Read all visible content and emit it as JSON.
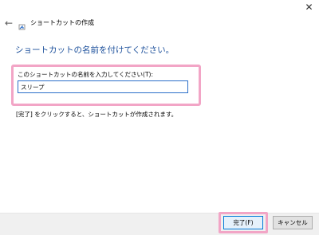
{
  "window": {
    "title": "ショートカットの作成",
    "close_glyph": "✕",
    "back_glyph": "←"
  },
  "main": {
    "heading": "ショートカットの名前を付けてください。",
    "field_label": "このショートカットの名前を入力してください(T):",
    "name_value": "スリープ",
    "info_text": "[完了] をクリックすると、ショートカットが作成されます。"
  },
  "buttons": {
    "finish_label": "完了(F)",
    "cancel_label": "キャンセル"
  },
  "colors": {
    "heading": "#1b4f9b",
    "highlight": "#f2a5c6",
    "focus_border": "#2b6fc9"
  }
}
